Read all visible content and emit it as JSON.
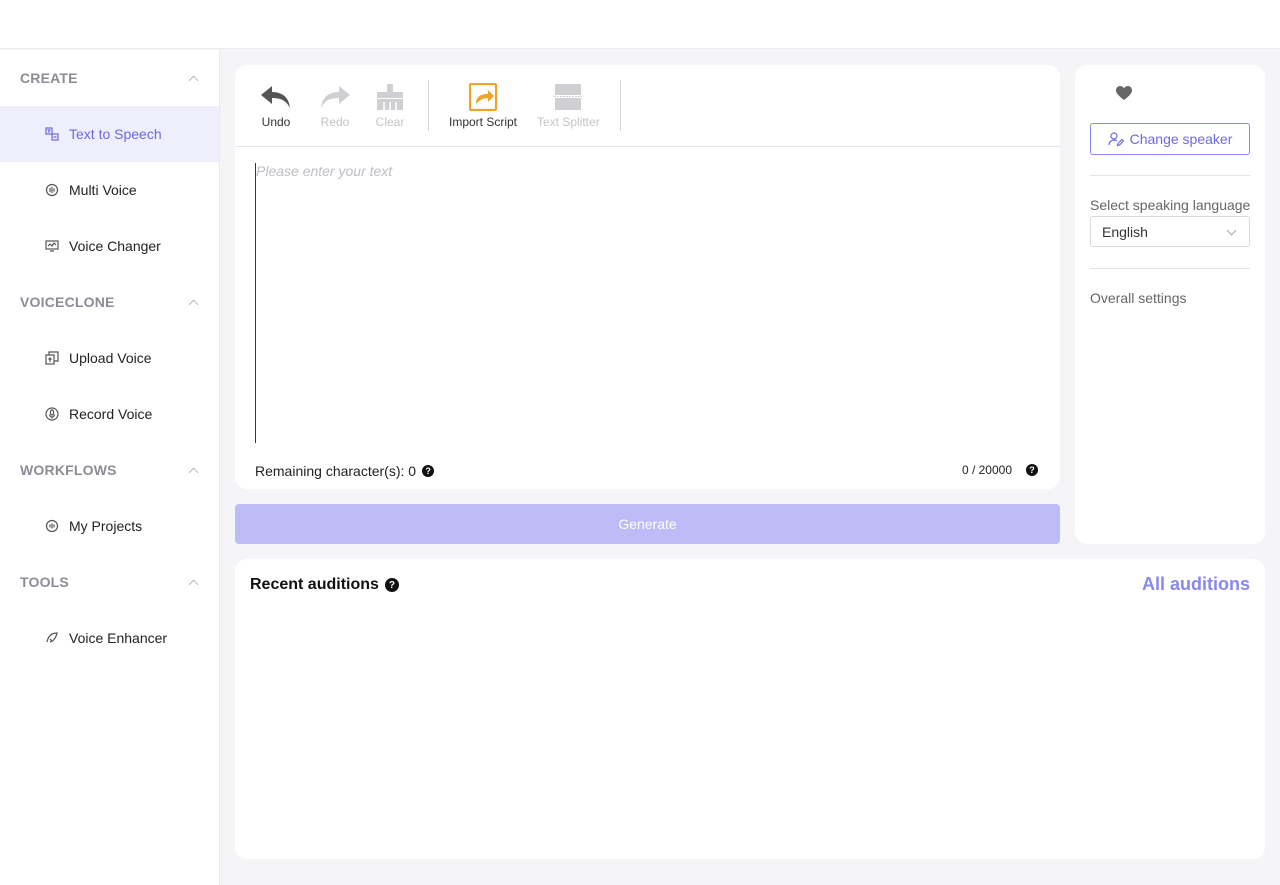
{
  "sidebar": {
    "sections": [
      {
        "title": "CREATE"
      },
      {
        "title": "VOICECLONE"
      },
      {
        "title": "WORKFLOWS"
      },
      {
        "title": "TOOLS"
      }
    ],
    "items": [
      {
        "label": "Text to Speech",
        "icon": "text-to-speech-icon",
        "active": true
      },
      {
        "label": "Multi Voice",
        "icon": "multi-voice-icon"
      },
      {
        "label": "Voice Changer",
        "icon": "voice-changer-icon"
      },
      {
        "label": "Upload Voice",
        "icon": "upload-voice-icon"
      },
      {
        "label": "Record Voice",
        "icon": "microphone-icon"
      },
      {
        "label": "My Projects",
        "icon": "projects-icon"
      },
      {
        "label": "Voice Enhancer",
        "icon": "voice-enhancer-icon"
      }
    ]
  },
  "toolbar": {
    "undo_label": "Undo",
    "redo_label": "Redo",
    "clear_label": "Clear",
    "import_label": "Import Script",
    "splitter_label": "Text Splitter"
  },
  "editor": {
    "placeholder": "Please enter your text",
    "remaining_label": "Remaining character(s): 0",
    "count": "0 / 20000"
  },
  "generate_label": "Generate",
  "right_panel": {
    "change_speaker_label": "Change speaker",
    "language_label": "Select speaking language",
    "language_value": "English",
    "overall_label": "Overall settings"
  },
  "recent": {
    "title": "Recent auditions",
    "all_link": "All auditions"
  },
  "colors": {
    "accent": "#6d6ae0",
    "accent_light": "#8a87ee",
    "generate_disabled": "#bdbbf8",
    "import_icon": "#f0a32a"
  }
}
